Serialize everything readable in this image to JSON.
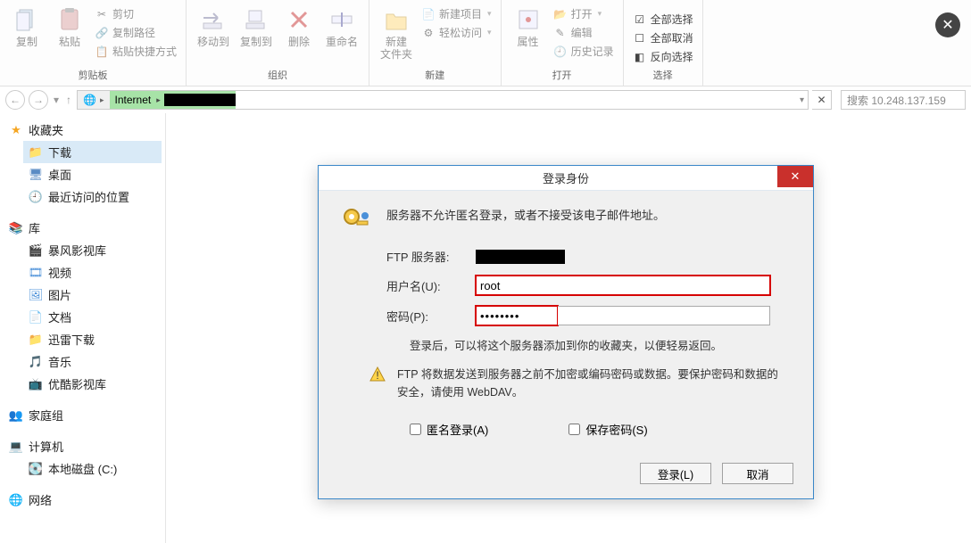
{
  "ribbon": {
    "clipboard": {
      "label": "剪贴板",
      "copy": "复制",
      "paste": "粘贴",
      "cut": "剪切",
      "copy_path": "复制路径",
      "paste_shortcut": "粘贴快捷方式"
    },
    "organize": {
      "label": "组织",
      "move_to": "移动到",
      "copy_to": "复制到",
      "delete": "删除",
      "rename": "重命名"
    },
    "new": {
      "label": "新建",
      "new_folder": "新建\n文件夹",
      "new_item": "新建项目",
      "easy_access": "轻松访问"
    },
    "open": {
      "label": "打开",
      "properties": "属性",
      "open": "打开",
      "edit": "编辑",
      "history": "历史记录"
    },
    "select": {
      "label": "选择",
      "select_all": "全部选择",
      "select_none": "全部取消",
      "invert": "反向选择"
    }
  },
  "breadcrumb": {
    "segment": "Internet",
    "dropdown_hint": "▾"
  },
  "search": {
    "placeholder": "搜索 10.248.137.159"
  },
  "tree": {
    "favorites": {
      "label": "收藏夹",
      "downloads": "下载",
      "desktop": "桌面",
      "recent": "最近访问的位置"
    },
    "libraries": {
      "label": "库",
      "baofeng": "暴风影视库",
      "videos": "视频",
      "pictures": "图片",
      "documents": "文档",
      "xunlei": "迅雷下载",
      "music": "音乐",
      "youku": "优酷影视库"
    },
    "homegroup": "家庭组",
    "computer": {
      "label": "计算机",
      "drive_c": "本地磁盘 (C:)"
    },
    "network": "网络"
  },
  "dialog": {
    "title": "登录身份",
    "message": "服务器不允许匿名登录，或者不接受该电子邮件地址。",
    "ftp_label": "FTP 服务器:",
    "user_label": "用户名(U):",
    "user_value": "root",
    "pass_label": "密码(P):",
    "pass_value": "••••••••",
    "hint": "登录后，可以将这个服务器添加到你的收藏夹，以便轻易返回。",
    "warning": "FTP 将数据发送到服务器之前不加密或编码密码或数据。要保护密码和数据的安全，请使用 WebDAV。",
    "anon": "匿名登录(A)",
    "save_pw": "保存密码(S)",
    "login": "登录(L)",
    "cancel": "取消"
  }
}
